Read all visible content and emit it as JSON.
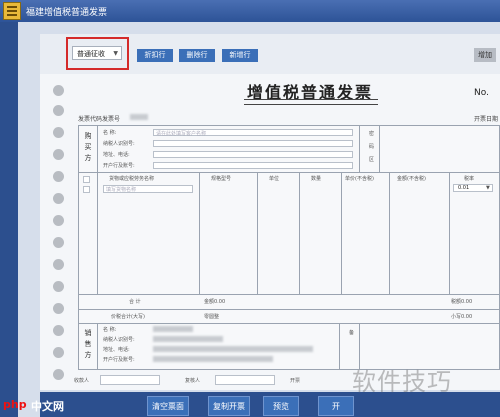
{
  "window": {
    "title": "福建增值税普通发票"
  },
  "toolbar": {
    "invoice_type": "普通征收",
    "buttons": [
      "折扣行",
      "删除行",
      "新增行"
    ],
    "right_button": "增加"
  },
  "invoice": {
    "title": "增值税普通发票",
    "no_label": "No.",
    "code_label": "发票代码发票号",
    "date_label": "开票日期",
    "buyer": {
      "section": "购买方",
      "rows": [
        "名 称:",
        "纳税人识别号:",
        "地址、电话:",
        "开户行及账号:"
      ],
      "name_placeholder": "请在此处填写客户名称",
      "side": [
        "密",
        "码",
        "区"
      ]
    },
    "columns": [
      "货物或应税劳务名称",
      "规格型号",
      "单位",
      "数量",
      "单价(不含税)",
      "金额(不含税)",
      "税率"
    ],
    "first_row": {
      "name_placeholder": "填写货物名称",
      "tax_rate": "0.01"
    },
    "total": {
      "label": "合  计",
      "amount": "金额0.00",
      "tax": "税额0.00"
    },
    "grand_total": {
      "label": "价税合计(大写)",
      "words": "零圆整",
      "small": "小写0.00"
    },
    "seller": {
      "section": "销售方",
      "rows": [
        "名 称:",
        "纳税人识别号:",
        "地址、电话:",
        "开户行及账号:"
      ],
      "remark": "备"
    },
    "footer": [
      "收款人",
      "复核人",
      "开票"
    ]
  },
  "bottom_buttons": [
    "清空票面",
    "复制开票",
    "预览",
    "开"
  ],
  "watermark": "软件技巧",
  "site": {
    "logo": "php",
    "name": "中文网"
  },
  "colors": {
    "title_bar": "#2d5397",
    "accent_button": "#3b6fb8",
    "highlight": "#d42a2a"
  }
}
